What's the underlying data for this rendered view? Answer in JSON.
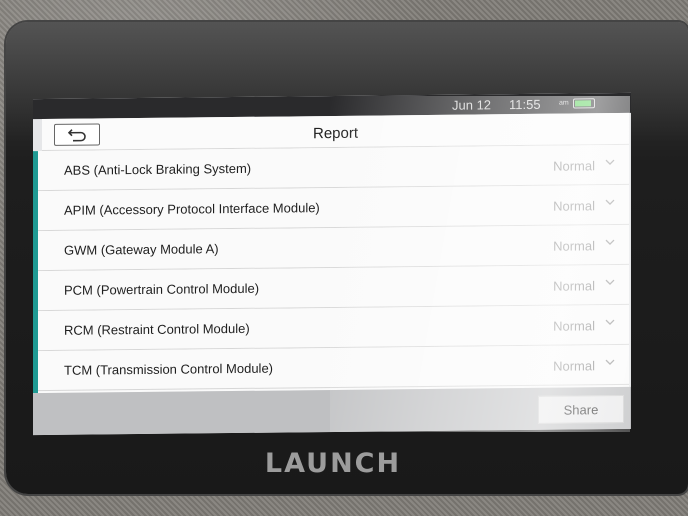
{
  "status_bar": {
    "date": "Jun 12",
    "time": "11:55",
    "ampm": "am"
  },
  "header": {
    "title": "Report"
  },
  "modules": [
    {
      "name": "ABS (Anti-Lock Braking System)",
      "status": "Normal"
    },
    {
      "name": "APIM (Accessory Protocol Interface Module)",
      "status": "Normal"
    },
    {
      "name": "GWM (Gateway Module A)",
      "status": "Normal"
    },
    {
      "name": "PCM (Powertrain Control Module)",
      "status": "Normal"
    },
    {
      "name": "RCM (Restraint Control Module)",
      "status": "Normal"
    },
    {
      "name": "TCM (Transmission Control Module)",
      "status": "Normal"
    }
  ],
  "footer": {
    "share_label": "Share"
  },
  "device": {
    "brand": "LAUNCH"
  },
  "colors": {
    "accent": "#1f9a93",
    "battery": "#58d158"
  }
}
